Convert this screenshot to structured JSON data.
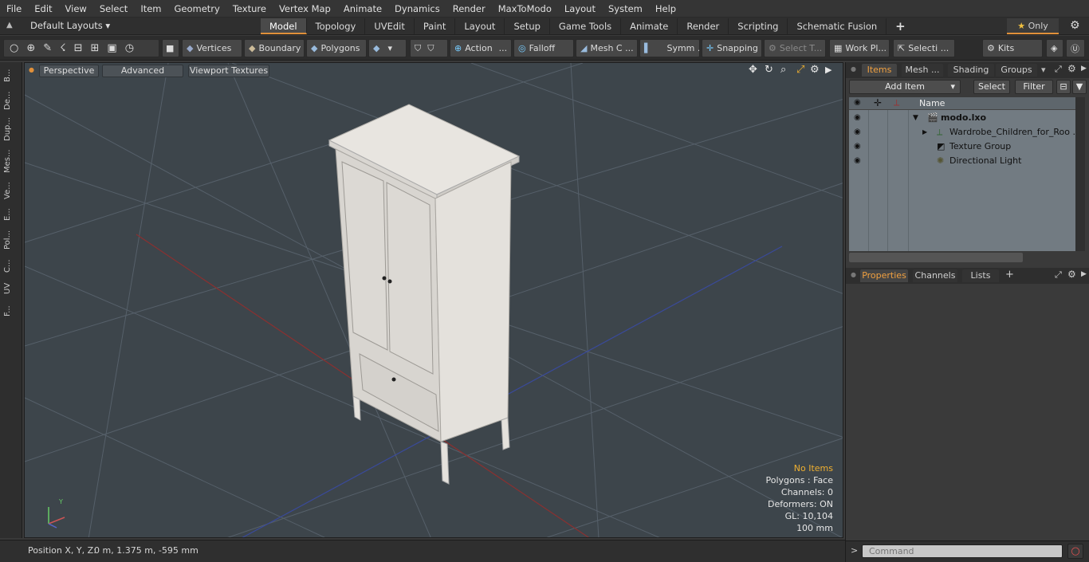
{
  "menu": [
    "File",
    "Edit",
    "View",
    "Select",
    "Item",
    "Geometry",
    "Texture",
    "Vertex Map",
    "Animate",
    "Dynamics",
    "Render",
    "MaxToModo",
    "Layout",
    "System",
    "Help"
  ],
  "layout_selector": "Default Layouts",
  "layout_tabs": [
    "Model",
    "Topology",
    "UVEdit",
    "Paint",
    "Layout",
    "Setup",
    "Game Tools",
    "Animate",
    "Render",
    "Scripting",
    "Schematic Fusion"
  ],
  "active_layout_tab": "Model",
  "only_label": "Only",
  "toolbar": {
    "vertices": "Vertices",
    "boundary": "Boundary",
    "polygons": "Polygons",
    "action": "Action",
    "falloff": "Falloff",
    "mesh_c": "Mesh C ...",
    "symm": "Symm ...",
    "snapping": "Snapping",
    "select_t": "Select T...",
    "work_pl": "Work Pl...",
    "selecti": "Selecti ...",
    "kits": "Kits"
  },
  "left_tabs": [
    "B...",
    "De...",
    "Dup...",
    "Mes...",
    "Ve...",
    "E...",
    "Pol...",
    "C...",
    "UV",
    "F..."
  ],
  "viewport": {
    "perspective": "Perspective",
    "advanced": "Advanced",
    "viewport_textures": "Viewport Textures"
  },
  "stats": {
    "no_items": "No Items",
    "polygons": "Polygons : Face",
    "channels": "Channels: 0",
    "deformers": "Deformers: ON",
    "gl": "GL: 10,104",
    "scale": "100 mm"
  },
  "status": {
    "position_label": "Position X, Y, Z:",
    "position_value": "0 m, 1.375 m, -595 mm"
  },
  "panel_tabs": [
    "Items",
    "Mesh ...",
    "Shading",
    "Groups"
  ],
  "add_item": "Add Item",
  "select_btn": "Select",
  "filter_btn": "Filter",
  "col_name": "Name",
  "items": [
    {
      "label": "modo.lxo",
      "kind": "scene"
    },
    {
      "label": "Wardrobe_Children_for_Roo ...",
      "kind": "mesh"
    },
    {
      "label": "Texture Group",
      "kind": "texture"
    },
    {
      "label": "Directional Light",
      "kind": "light"
    }
  ],
  "props_tabs": [
    "Properties",
    "Channels",
    "Lists"
  ],
  "command_placeholder": "Command",
  "colors": {
    "accent": "#e0903a",
    "viewport_bg": "#3d454b",
    "list_bg": "#727b82"
  }
}
